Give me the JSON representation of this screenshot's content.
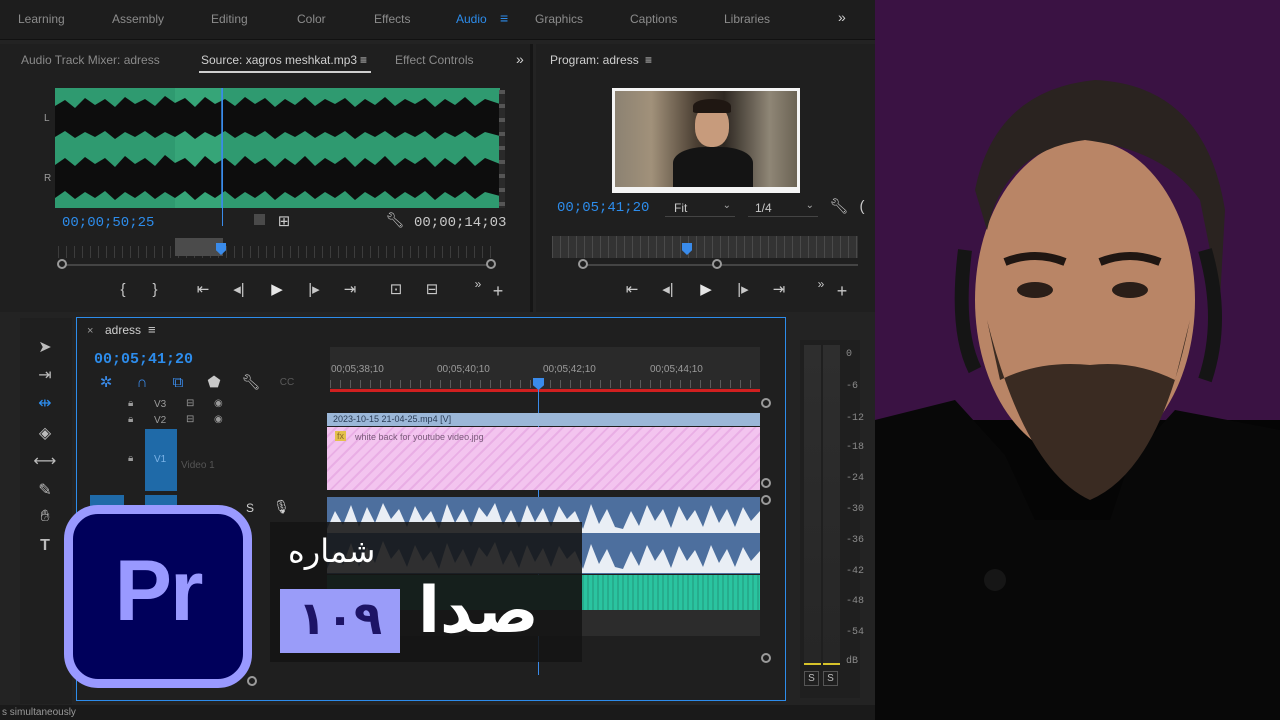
{
  "workspaces": [
    "Learning",
    "Assembly",
    "Editing",
    "Color",
    "Effects",
    "Audio",
    "Graphics",
    "Captions",
    "Libraries"
  ],
  "workspace_active": "Audio",
  "workspace_overflow": "»",
  "source_panel": {
    "tabs": [
      "Audio Track Mixer: adress",
      "Source: xagros meshkat.mp3",
      "Effect Controls"
    ],
    "active_tab_menu": "≡",
    "channel_L": "L",
    "channel_R": "R",
    "timecode": "00;00;50;25",
    "duration": "00;00;14;03"
  },
  "program_panel": {
    "title": "Program: adress",
    "menu": "≡",
    "timecode": "00;05;41;20",
    "fit": "Fit",
    "resolution": "1/4"
  },
  "timeline": {
    "sequence_name": "adress",
    "menu": "≡",
    "timecode": "00;05;41;20",
    "ruler": [
      "00;05;38;10",
      "00;05;40;10",
      "00;05;42;10",
      "00;05;44;10"
    ],
    "tracks": {
      "v3": "V3",
      "v2": "V2",
      "v1": "V1",
      "v1_name": "Video 1",
      "solo": "S"
    },
    "clip_video": "2023-10-15 21-04-25.mp4 [V]",
    "clip_image": "white back for youtube video.jpg",
    "clip_fx": "fx"
  },
  "meter": {
    "levels": [
      "0",
      "-6",
      "-12",
      "-18",
      "-24",
      "-30",
      "-36",
      "-42",
      "-48",
      "-54",
      "dB"
    ],
    "solo_buttons": [
      "S",
      "S"
    ]
  },
  "overlay": {
    "logo": "Pr",
    "episode_label": "شماره",
    "episode_number": "۱۰۹",
    "title": "صدا"
  },
  "status_bar": "s simultaneously",
  "colors": {
    "accent": "#2d8ceb",
    "waveform": "#2f9a70",
    "pink_clip": "#f3c4ef",
    "logo_bg": "#00005b",
    "logo_border": "#9999ff"
  }
}
